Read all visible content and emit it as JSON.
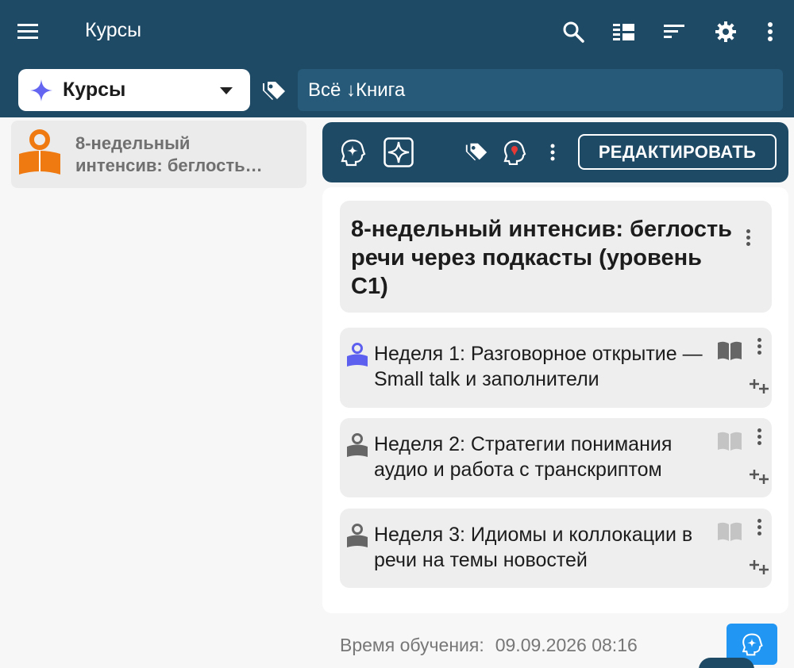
{
  "appbar": {
    "title": "Курсы",
    "icons": [
      "menu-icon",
      "search-icon",
      "view-toggle-icon",
      "sort-icon",
      "gear-icon",
      "more-vert-icon"
    ]
  },
  "filters": {
    "course_type_label": "Курсы",
    "filter_text": "Всё ↓Книга"
  },
  "sidebar": {
    "items": [
      {
        "title": "8-недельный интенсив: беглость…",
        "line1": "8-недельный",
        "line2": "интенсив: беглость…"
      }
    ]
  },
  "detail_toolbar": {
    "edit_label": "РЕДАКТИРОВАТЬ",
    "icons": [
      "head-sparkle-icon",
      "sparkle-icon",
      "tags-icon",
      "head-pin-icon",
      "more-vert-icon"
    ]
  },
  "course": {
    "title": "8-недельный интенсив: беглость речи через подкасты (уровень C1)"
  },
  "weeks": [
    {
      "title": "Неделя 1: Разговорное открытие — Small talk и заполнители",
      "icon_color": "#5d5fef",
      "book_color": "#666666"
    },
    {
      "title": "Неделя 2: Стратегии понимания аудио и работа с транскриптом",
      "icon_color": "#666666",
      "book_color": "#c4c4c4"
    },
    {
      "title": "Неделя 3: Идиомы и коллокации в речи на темы новостей",
      "icon_color": "#666666",
      "book_color": "#c4c4c4"
    }
  ],
  "footer": {
    "study_time_label": "Время обучения:",
    "study_time_value": "09.09.2026 08:16"
  },
  "colors": {
    "appbar": "#1f4a66",
    "accent_orange": "#f07a12",
    "accent_purple": "#5d5fef",
    "fab": "#2196f3"
  }
}
